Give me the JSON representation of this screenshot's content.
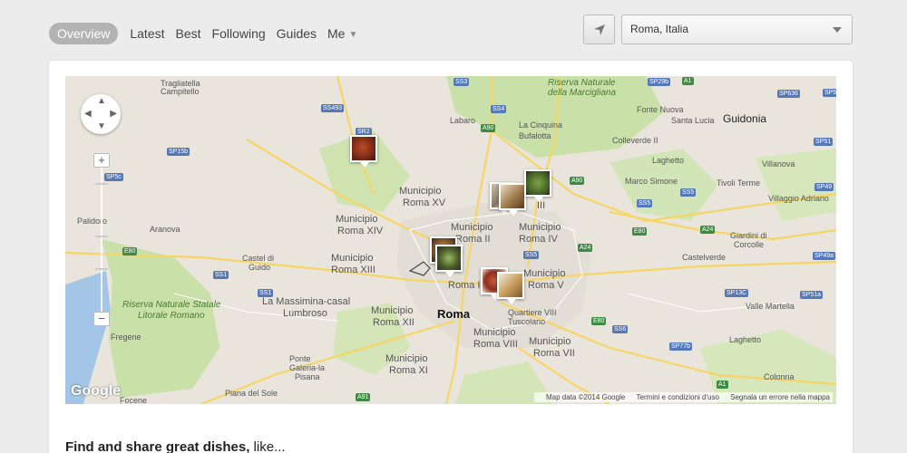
{
  "nav": {
    "tabs": [
      {
        "label": "Overview",
        "active": true
      },
      {
        "label": "Latest"
      },
      {
        "label": "Best"
      },
      {
        "label": "Following"
      },
      {
        "label": "Guides"
      },
      {
        "label": "Me",
        "has_dropdown": true
      }
    ]
  },
  "location": {
    "button_icon": "location-arrow-icon",
    "selected": "Roma, Italia"
  },
  "map": {
    "labels": {
      "tragliatella": "Tragliatella",
      "campitello": "Campitello",
      "riserva_marcigliana_1": "Riserva Naturale",
      "riserva_marcigliana_2": "della Marcigliana",
      "fonte_nuova": "Fonte Nuova",
      "santa_lucia": "Santa Lucia",
      "guidonia": "Guidonia",
      "labaro": "Labaro",
      "la_cinquina": "La Cinquina",
      "bufalotta": "Bufalotta",
      "colleverde": "Colleverde II",
      "laghetto": "Laghetto",
      "villanova": "Villanova",
      "marco_simone": "Marco Simone",
      "tivoli_terme": "Tivoli Terme",
      "villaggio_adriano": "Villaggio Adriano",
      "mun_xv_1": "Municipio",
      "mun_xv_2": "Roma XV",
      "mun_ii_1": "Municipio",
      "mun_ii_2": "Roma II",
      "mun_iii": "III",
      "mun_iv_1": "Municipio",
      "mun_iv_2": "Roma IV",
      "mun_xiv_1": "Municipio",
      "mun_xiv_2": "Roma XIV",
      "aranova": "Aranova",
      "palidoro": "Palidoro",
      "castel_di_guido_1": "Castel di",
      "castel_di_guido_2": "Guido",
      "mun_xiii_1": "Municipio",
      "mun_xiii_2": "Roma XIII",
      "mun_i": "Roma I",
      "mun_v_1": "Municipio",
      "mun_v_2": "Roma V",
      "giardini_1": "Giardini di",
      "giardini_2": "Corcolle",
      "castelverde": "Castelverde",
      "massimina_1": "La Massimina-casal",
      "massimina_2": "Lumbroso",
      "riserva_litorale_1": "Riserva Naturale Statale",
      "riserva_litorale_2": "Litorale Romano",
      "mun_xii_1": "Municipio",
      "mun_xii_2": "Roma XII",
      "roma": "Roma",
      "quartiere_1": "Quartiere VIII",
      "quartiere_2": "Tuscolano",
      "valle_martella": "Valle Martella",
      "fregene": "Fregene",
      "mun_viii_1": "Municipio",
      "mun_viii_2": "Roma VIII",
      "mun_vii_1": "Municipio",
      "mun_vii_2": "Roma VII",
      "laghetto2": "Laghetto",
      "mun_xi_1": "Municipio",
      "mun_xi_2": "Roma XI",
      "ponte_galeria_1": "Ponte",
      "ponte_galeria_2": "Galeria-la",
      "ponte_galeria_3": "Pisana",
      "piana_del_sole": "Piana del Sole",
      "focene": "Focene",
      "colonna": "Colonna"
    },
    "shields": {
      "ss3": "SS3",
      "sp29b": "SP29b",
      "a1_top": "A1",
      "sp636": "SP636",
      "sp5": "SP5",
      "ss493": "SS493",
      "ss4": "SS4",
      "sr2": "SR2",
      "a90_n": "A90",
      "sp15b": "SP15b",
      "sp51": "SP51",
      "sp5c": "SP5c",
      "a90_e": "A90",
      "ss5": "SS5",
      "ss5b": "SS5",
      "sp49": "SP49",
      "e80_w": "E80",
      "a24": "A24",
      "e80_e": "E80",
      "a24b": "A24",
      "sp49a": "SP49a",
      "ss1": "SS1",
      "ss5c": "SS5",
      "ss1b": "SS1",
      "sp13c": "SP13C",
      "sp51a": "SP51a",
      "e80_s": "E80",
      "ss6": "SS6",
      "sp77b": "SP77b",
      "a1_s": "A1",
      "a91": "A91"
    },
    "google": "Google",
    "footer": {
      "data": "Map data ©2014 Google",
      "terms": "Termini e condizioni d'uso",
      "report": "Segnala un errore nella mappa"
    }
  },
  "headline": {
    "bold": "Find and share great dishes,",
    "rest": " like..."
  },
  "colors": {
    "active_tab_bg": "#b3b3b3",
    "map_green": "#c8dfa8",
    "map_sea": "#a3c5e6",
    "road_yellow": "#f6d564"
  }
}
